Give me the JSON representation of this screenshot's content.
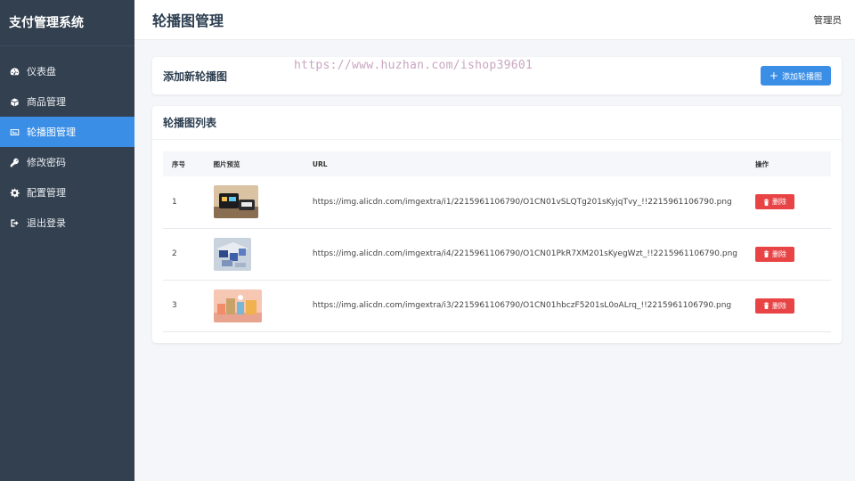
{
  "sidebar": {
    "brand": "支付管理系统",
    "items": [
      {
        "label": "仪表盘",
        "icon": "dashboard-icon",
        "active": false
      },
      {
        "label": "商品管理",
        "icon": "box-icon",
        "active": false
      },
      {
        "label": "轮播图管理",
        "icon": "image-icon",
        "active": true
      },
      {
        "label": "修改密码",
        "icon": "key-icon",
        "active": false
      },
      {
        "label": "配置管理",
        "icon": "gear-icon",
        "active": false
      },
      {
        "label": "退出登录",
        "icon": "logout-icon",
        "active": false
      }
    ]
  },
  "header": {
    "title": "轮播图管理",
    "user": "管理员"
  },
  "add_card": {
    "title": "添加新轮播图",
    "button_label": "添加轮播图"
  },
  "watermark": "https://www.huzhan.com/ishop39601",
  "list_card": {
    "title": "轮播图列表",
    "columns": [
      "序号",
      "图片预览",
      "URL",
      "操作"
    ],
    "rows": [
      {
        "index": "1",
        "url": "https://img.alicdn.com/imgextra/i1/2215961106790/O1CN01vSLQTg201sKyjqTvy_!!2215961106790.png",
        "delete_label": "删除"
      },
      {
        "index": "2",
        "url": "https://img.alicdn.com/imgextra/i4/2215961106790/O1CN01PkR7XM201sKyegWzt_!!2215961106790.png",
        "delete_label": "删除"
      },
      {
        "index": "3",
        "url": "https://img.alicdn.com/imgextra/i3/2215961106790/O1CN01hbczF5201sL0oALrq_!!2215961106790.png",
        "delete_label": "删除"
      }
    ]
  },
  "colors": {
    "sidebar_bg": "#33404f",
    "active_item": "#3a8ee6",
    "primary_button": "#3a8ee6",
    "danger_button": "#e84446"
  }
}
